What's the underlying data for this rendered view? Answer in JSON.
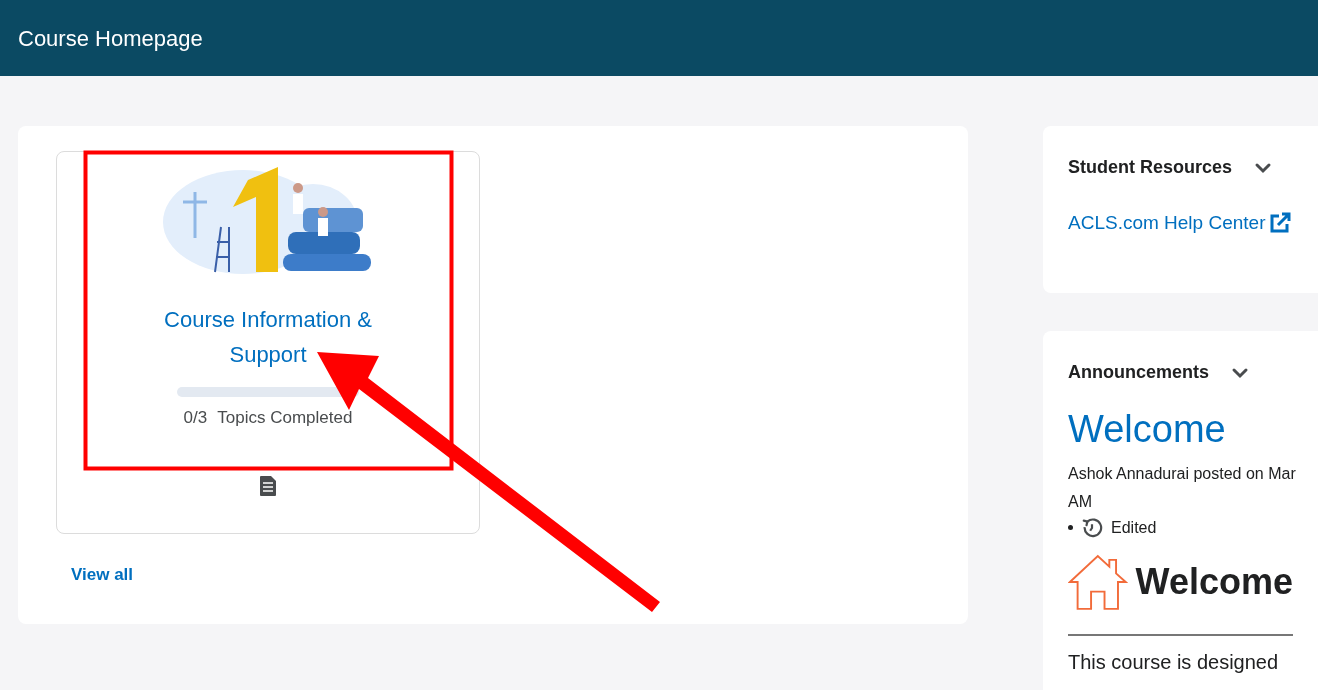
{
  "header": {
    "title": "Course Homepage"
  },
  "modules": [
    {
      "title": "Course Information & Support",
      "level": 0,
      "progress_count": "0/3",
      "progress_label": "Topics Completed"
    }
  ],
  "view_all": "View all",
  "student_resources": {
    "title": "Student Resources",
    "expanded": true,
    "links": [
      "ACLS.com Help Center"
    ]
  },
  "announcements": {
    "title": "Announcements",
    "expanded": true,
    "item_title": "Welcome",
    "posted_lines": [
      "Ashok Annadurai posted on Mar",
      "AM"
    ],
    "edited": "Edited",
    "heading": "Welcome",
    "body": "This course is designed"
  }
}
